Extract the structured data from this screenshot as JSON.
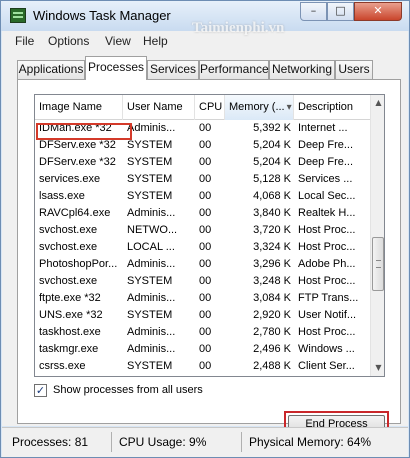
{
  "window": {
    "title": "Windows Task Manager",
    "controls": {
      "minimize": "–",
      "maximize": "□",
      "close": "✕"
    }
  },
  "menu": [
    {
      "label": "File"
    },
    {
      "label": "Options"
    },
    {
      "label": "View"
    },
    {
      "label": "Help"
    }
  ],
  "tabs": [
    {
      "label": "Applications",
      "active": false
    },
    {
      "label": "Processes",
      "active": true
    },
    {
      "label": "Services",
      "active": false
    },
    {
      "label": "Performance",
      "active": false
    },
    {
      "label": "Networking",
      "active": false
    },
    {
      "label": "Users",
      "active": false
    }
  ],
  "columns": [
    {
      "label": "Image Name"
    },
    {
      "label": "User Name"
    },
    {
      "label": "CPU"
    },
    {
      "label": "Memory (...",
      "sorted": true,
      "sort_glyph": "▾"
    },
    {
      "label": "Description"
    }
  ],
  "processes": [
    [
      "IDMan.exe *32",
      "Adminis...",
      "00",
      "5,392 K",
      "Internet ..."
    ],
    [
      "DFServ.exe *32",
      "SYSTEM",
      "00",
      "5,204 K",
      "Deep Fre..."
    ],
    [
      "DFServ.exe *32",
      "SYSTEM",
      "00",
      "5,204 K",
      "Deep Fre..."
    ],
    [
      "services.exe",
      "SYSTEM",
      "00",
      "5,128 K",
      "Services ..."
    ],
    [
      "lsass.exe",
      "SYSTEM",
      "00",
      "4,068 K",
      "Local Sec..."
    ],
    [
      "RAVCpl64.exe",
      "Adminis...",
      "00",
      "3,840 K",
      "Realtek H..."
    ],
    [
      "svchost.exe",
      "NETWO...",
      "00",
      "3,720 K",
      "Host Proc..."
    ],
    [
      "svchost.exe",
      "LOCAL ...",
      "00",
      "3,324 K",
      "Host Proc..."
    ],
    [
      "PhotoshopPor...",
      "Adminis...",
      "00",
      "3,296 K",
      "Adobe Ph..."
    ],
    [
      "svchost.exe",
      "SYSTEM",
      "00",
      "3,248 K",
      "Host Proc..."
    ],
    [
      "ftpte.exe *32",
      "Adminis...",
      "00",
      "3,084 K",
      "FTP Trans..."
    ],
    [
      "UNS.exe *32",
      "SYSTEM",
      "00",
      "2,920 K",
      "User Notif..."
    ],
    [
      "taskhost.exe",
      "Adminis...",
      "00",
      "2,780 K",
      "Host Proc..."
    ],
    [
      "taskmgr.exe",
      "Adminis...",
      "00",
      "2,496 K",
      "Windows ..."
    ],
    [
      "csrss.exe",
      "SYSTEM",
      "00",
      "2,488 K",
      "Client Ser..."
    ]
  ],
  "show_all": {
    "label": "Show processes from all users",
    "checked": true,
    "mark": "✓"
  },
  "end_process": {
    "label": "End Process"
  },
  "status": {
    "processes": "Processes: 81",
    "cpu": "CPU Usage: 9%",
    "memory": "Physical Memory: 64%"
  },
  "watermarks": [
    "Taimienphi.vn",
    "Taimienphi.vn"
  ],
  "colors": {
    "highlight_border": "#d43a2a",
    "title_gradient_top": "#e7f0fa",
    "close_button": "#c9452c"
  }
}
